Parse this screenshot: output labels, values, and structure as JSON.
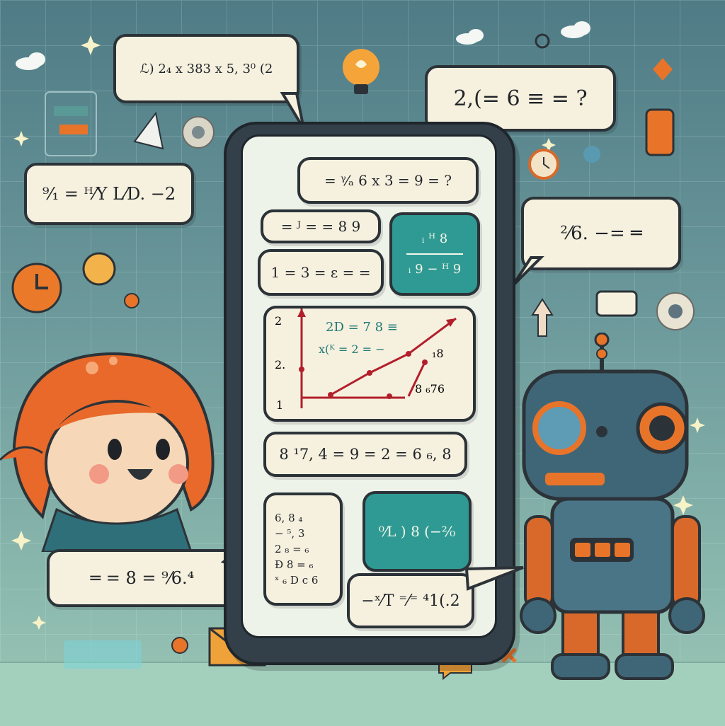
{
  "colors": {
    "background": "#5d8a91",
    "phone_body": "#33404a",
    "screen": "#eef3ea",
    "bubble": "#f6f0df",
    "accent_orange": "#e8742a",
    "accent_teal": "#2f9a93",
    "outline": "#2c3338"
  },
  "bubbles": {
    "top_left": "ℒ) 2₄ x 383 x 5, 3⁰ (2",
    "top_right": "2,(= 6 ≡ = ?",
    "left_mid": "⁹⁄₁ = ᴴ⁄Y  L⁄D. −2",
    "right_mid": "²⁄6. −= ═",
    "bottom_left": "═ = 8 = ⁹⁄6.⁴",
    "bottom_phone": "−ˣ⁄T ⁼⁄⁼ ⁴1(.2"
  },
  "screen": {
    "header_eq": "= ᵞ⁄ₐ 6 x 3 = 9 = ?",
    "msg1": "= ᴶ = = 8 9",
    "msg2": "1 = 3 = ε = =",
    "teal1_top": "ᵢ ᴴ 8",
    "teal1_bottom": "ᵢ 9 − ᴴ 9",
    "graph_eq_top": "2D = 7 8 ≡",
    "graph_eq_mid": "x(ᴷ = 2 = −",
    "graph_label_left_top": "2",
    "graph_label_left_mid": "2.",
    "graph_label_left_bottom": "1",
    "graph_side_top": "₁8",
    "graph_side_bottom": "8 ₆76",
    "msg3": "8 ¹7, 4 = 9 = 2 = 6 ₆, 8",
    "note_lines": [
      "6, 8 ₄",
      "− ⁵, 3",
      "2 ₈ = ₆",
      "Ɖ 8 = ₆",
      "ˣ ₆ D c 6"
    ],
    "teal2": "⁰⁄L ) 8 (−²⁄₀"
  },
  "icons": [
    "lightbulb-icon",
    "gear-icon",
    "clock-icon",
    "envelope-icon",
    "robot-icon",
    "girl-character-icon",
    "sparkle-icon",
    "cloud-icon"
  ]
}
